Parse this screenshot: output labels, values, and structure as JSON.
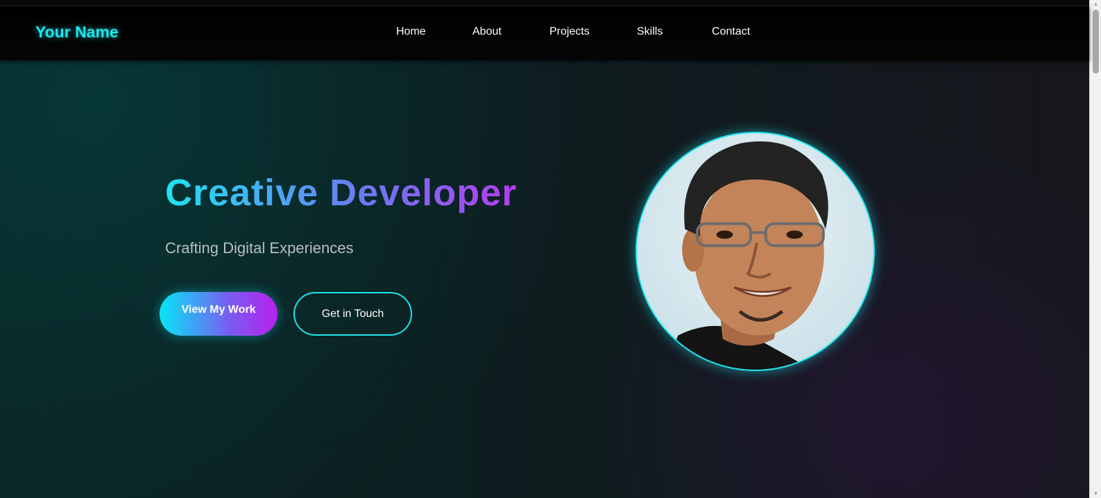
{
  "navbar": {
    "brand": "Your Name",
    "links": [
      "Home",
      "About",
      "Projects",
      "Skills",
      "Contact"
    ]
  },
  "hero": {
    "title": "Creative Developer",
    "subtitle": "Crafting Digital Experiences",
    "primary_button": "View My Work",
    "secondary_button": "Get in Touch"
  },
  "colors": {
    "accent": "#1ee6f0",
    "gradient_start": "#07e6f7",
    "gradient_end": "#b820f0",
    "navbar_bg": "#000000"
  },
  "scrollbar": {
    "up_icon": "▲",
    "down_icon": "▼"
  }
}
